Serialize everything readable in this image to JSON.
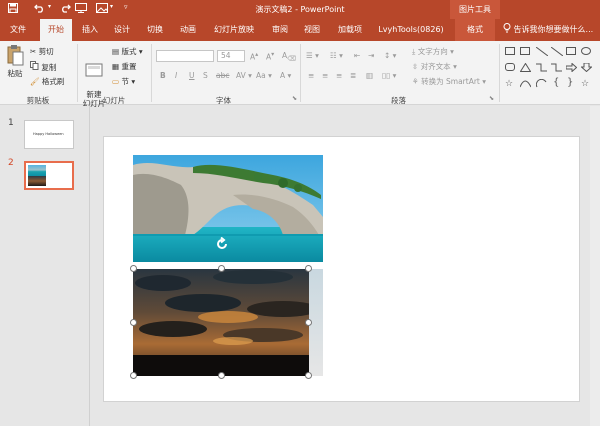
{
  "window": {
    "title": "演示文稿2 - PowerPoint",
    "context_tab_group": "图片工具"
  },
  "tabs": [
    "文件",
    "开始",
    "插入",
    "设计",
    "切换",
    "动画",
    "幻灯片放映",
    "审阅",
    "视图",
    "加载项",
    "LvyhTools(0826)",
    "格式"
  ],
  "tell_me": "告诉我你想要做什么...",
  "ribbon": {
    "clipboard": {
      "label": "剪贴板",
      "paste": "粘贴",
      "cut": "剪切",
      "copy": "复制",
      "format_painter": "格式刷"
    },
    "slides": {
      "label": "幻灯片",
      "new_slide": "新建\n幻灯片",
      "layout": "版式",
      "reset": "重置",
      "section": "节"
    },
    "font": {
      "label": "字体",
      "font_size": "54"
    },
    "paragraph": {
      "label": "段落",
      "text_direction": "文字方向",
      "align_text": "对齐文本",
      "convert_smartart": "转换为 SmartArt"
    }
  },
  "thumbnails": [
    {
      "number": "1",
      "text": "Happy Halloween"
    },
    {
      "number": "2",
      "text": ""
    }
  ],
  "colors": {
    "brand": "#b7472a",
    "ribbon_bg": "#f3f3f3",
    "selected_thumb": "#e86d4c"
  }
}
